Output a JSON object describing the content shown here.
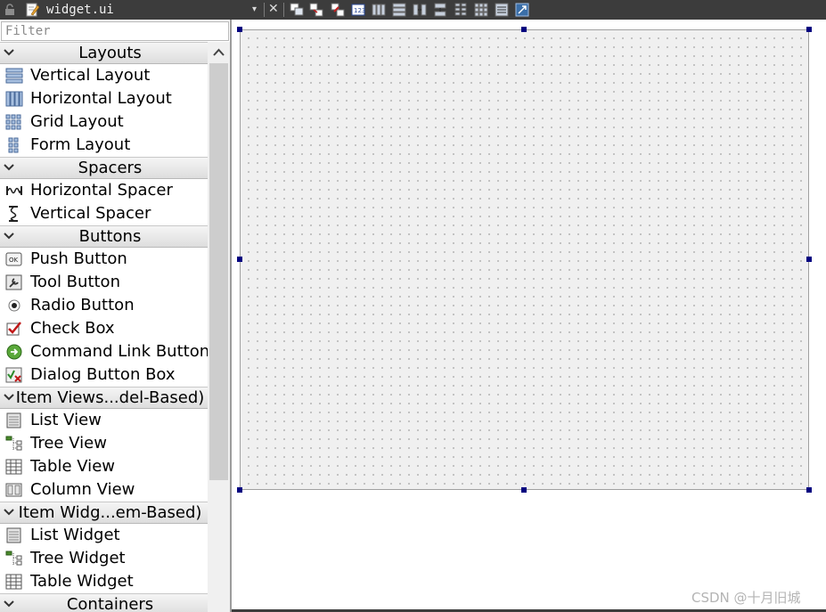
{
  "topbar": {
    "file_title": "widget.ui",
    "dropdown_glyph": "▾",
    "close_glyph": "✕",
    "toolbar_icons": [
      "edit-widgets-icon",
      "edit-signals-slots-icon",
      "edit-buddies-icon",
      "edit-tab-order-icon",
      "layout-horizontal-icon",
      "layout-vertical-icon",
      "layout-horizontal-splitter-icon",
      "layout-vertical-splitter-icon",
      "layout-form-icon",
      "layout-grid-icon",
      "break-layout-icon",
      "adjust-size-icon"
    ]
  },
  "widget_box": {
    "filter_placeholder": "Filter",
    "sections": [
      {
        "label": "Layouts",
        "items": [
          {
            "label": "Vertical Layout",
            "icon": "vertical-layout-icon"
          },
          {
            "label": "Horizontal Layout",
            "icon": "horizontal-layout-icon"
          },
          {
            "label": "Grid Layout",
            "icon": "grid-layout-icon"
          },
          {
            "label": "Form Layout",
            "icon": "form-layout-icon"
          }
        ]
      },
      {
        "label": "Spacers",
        "items": [
          {
            "label": "Horizontal Spacer",
            "icon": "horizontal-spacer-icon"
          },
          {
            "label": "Vertical Spacer",
            "icon": "vertical-spacer-icon"
          }
        ]
      },
      {
        "label": "Buttons",
        "items": [
          {
            "label": "Push Button",
            "icon": "push-button-icon"
          },
          {
            "label": "Tool Button",
            "icon": "tool-button-icon"
          },
          {
            "label": "Radio Button",
            "icon": "radio-button-icon"
          },
          {
            "label": "Check Box",
            "icon": "check-box-icon"
          },
          {
            "label": "Command Link Button",
            "icon": "command-link-icon"
          },
          {
            "label": "Dialog Button Box",
            "icon": "dialog-button-box-icon"
          }
        ]
      },
      {
        "label": "Item Views...del-Based)",
        "items": [
          {
            "label": "List View",
            "icon": "list-view-icon"
          },
          {
            "label": "Tree View",
            "icon": "tree-view-icon"
          },
          {
            "label": "Table View",
            "icon": "table-view-icon"
          },
          {
            "label": "Column View",
            "icon": "column-view-icon"
          }
        ]
      },
      {
        "label": "Item Widg...em-Based)",
        "items": [
          {
            "label": "List Widget",
            "icon": "list-widget-icon"
          },
          {
            "label": "Tree Widget",
            "icon": "tree-widget-icon"
          },
          {
            "label": "Table Widget",
            "icon": "table-widget-icon"
          }
        ]
      },
      {
        "label": "Containers",
        "items": []
      }
    ]
  },
  "watermark": "CSDN @十月旧城"
}
